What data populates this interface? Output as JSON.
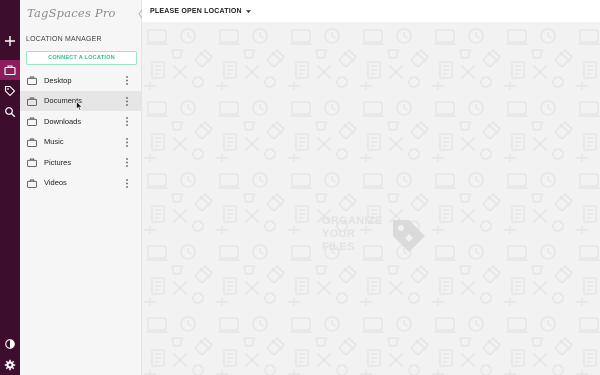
{
  "app": {
    "logo_text": "TagSpaces Pro"
  },
  "rail": {
    "buttons": [
      {
        "name": "add-icon"
      },
      {
        "name": "locations-icon",
        "active": true
      },
      {
        "name": "tags-icon"
      },
      {
        "name": "search-icon"
      },
      {
        "name": "theme-icon"
      },
      {
        "name": "settings-icon"
      }
    ]
  },
  "sidebar": {
    "section_title": "LOCATION MANAGER",
    "connect_label": "CONNECT A LOCATION",
    "locations": [
      {
        "label": "Desktop"
      },
      {
        "label": "Documents",
        "selected": true
      },
      {
        "label": "Downloads"
      },
      {
        "label": "Music"
      },
      {
        "label": "Pictures"
      },
      {
        "label": "Videos"
      }
    ]
  },
  "main": {
    "open_location_label": "PLEASE OPEN LOCATION",
    "watermark": [
      "ORGANIZE",
      "YOUR",
      "FILES"
    ]
  },
  "colors": {
    "rail_bg": "#3c0d2c",
    "rail_active": "#8b1d5f",
    "accent_green": "#2fc38a"
  }
}
